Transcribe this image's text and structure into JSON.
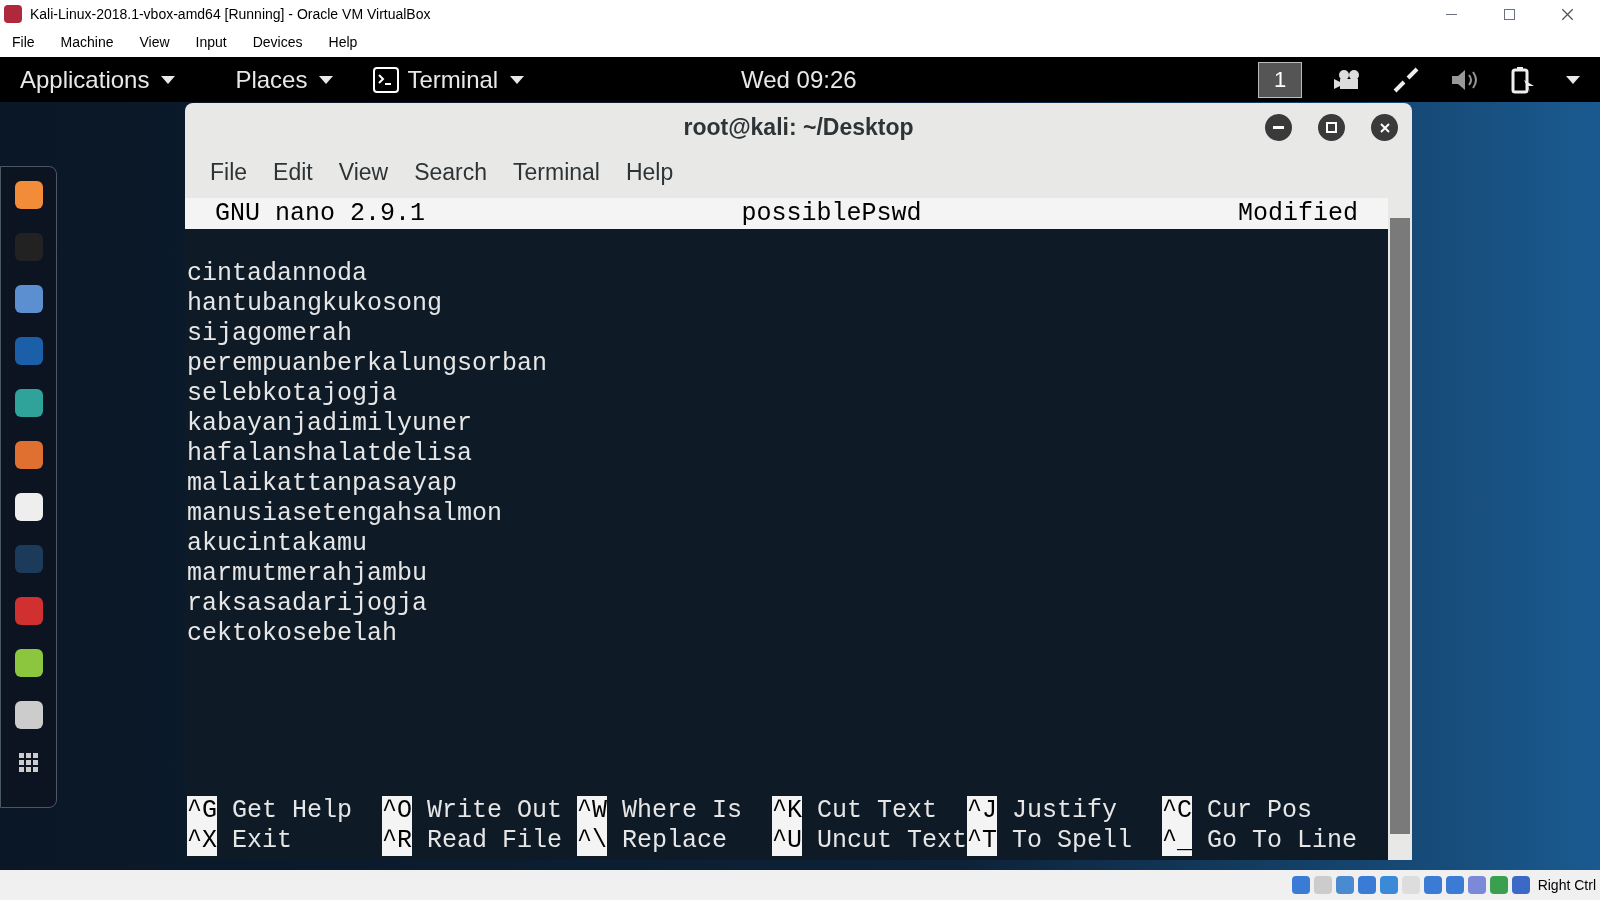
{
  "vbox": {
    "title": "Kali-Linux-2018.1-vbox-amd64 [Running] - Oracle VM VirtualBox",
    "menu": [
      "File",
      "Machine",
      "View",
      "Input",
      "Devices",
      "Help"
    ],
    "host_key": "Right Ctrl"
  },
  "top_bar": {
    "applications": "Applications",
    "places": "Places",
    "terminal": "Terminal",
    "clock": "Wed 09:26",
    "workspace": "1"
  },
  "terminal": {
    "title": "root@kali: ~/Desktop",
    "menu": [
      "File",
      "Edit",
      "View",
      "Search",
      "Terminal",
      "Help"
    ],
    "nano": {
      "version": "GNU nano 2.9.1",
      "filename": "possiblePswd",
      "status": "Modified",
      "lines": [
        "cintadannoda",
        "hantubangkukosong",
        "sijagomerah",
        "perempuanberkalungsorban",
        "selebkotajogja",
        "kabayanjadimilyuner",
        "hafalanshalatdelisa",
        "malaikattanpasayap",
        "manusiasetengahsalmon",
        "akucintakamu",
        "marmutmerahjambu",
        "raksasadarijogja",
        "cektokosebelah"
      ],
      "shortcuts": [
        {
          "key": "^G",
          "label": "Get Help"
        },
        {
          "key": "^X",
          "label": "Exit"
        },
        {
          "key": "^O",
          "label": "Write Out"
        },
        {
          "key": "^R",
          "label": "Read File"
        },
        {
          "key": "^W",
          "label": "Where Is"
        },
        {
          "key": "^\\",
          "label": "Replace"
        },
        {
          "key": "^K",
          "label": "Cut Text"
        },
        {
          "key": "^U",
          "label": "Uncut Text"
        },
        {
          "key": "^J",
          "label": "Justify"
        },
        {
          "key": "^T",
          "label": "To Spell"
        },
        {
          "key": "^C",
          "label": "Cur Pos"
        },
        {
          "key": "^_",
          "label": "Go To Line"
        }
      ]
    }
  }
}
